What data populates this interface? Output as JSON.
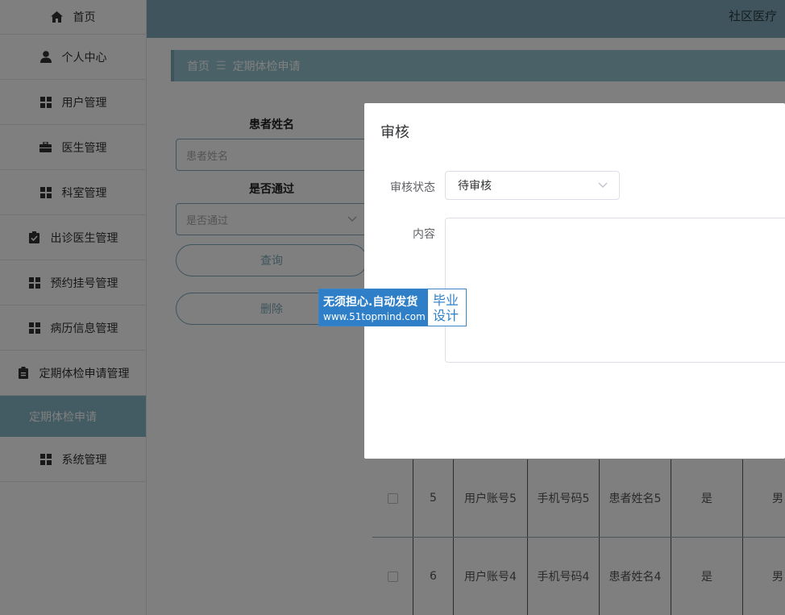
{
  "header": {
    "system_title": "社区医疗"
  },
  "sidebar": {
    "items": [
      {
        "label": "首页",
        "icon": "home-icon"
      },
      {
        "label": "个人中心",
        "icon": "user-icon"
      },
      {
        "label": "用户管理",
        "icon": "grid-icon"
      },
      {
        "label": "医生管理",
        "icon": "briefcase-icon"
      },
      {
        "label": "科室管理",
        "icon": "grid-icon"
      },
      {
        "label": "出诊医生管理",
        "icon": "clipboard-check-icon"
      },
      {
        "label": "预约挂号管理",
        "icon": "grid-icon"
      },
      {
        "label": "病历信息管理",
        "icon": "grid-icon"
      },
      {
        "label": "定期体检申请管理",
        "icon": "clipboard-icon"
      },
      {
        "label": "定期体检申请",
        "icon": ""
      },
      {
        "label": "系统管理",
        "icon": "grid-icon"
      }
    ]
  },
  "breadcrumb": {
    "home": "首页",
    "separator": "☰",
    "current": "定期体检申请"
  },
  "search": {
    "name_label": "患者姓名",
    "name_placeholder": "患者姓名",
    "pass_label": "是否通过",
    "pass_placeholder": "是否通过",
    "query_button": "查询",
    "delete_button": "删除"
  },
  "table": {
    "rows": [
      {
        "index": "5",
        "account": "用户账号5",
        "phone": "手机号码5",
        "name": "患者姓名5",
        "passed": "是",
        "gender": "男"
      },
      {
        "index": "6",
        "account": "用户账号4",
        "phone": "手机号码4",
        "name": "患者姓名4",
        "passed": "是",
        "gender": "男"
      }
    ]
  },
  "dialog": {
    "title": "审核",
    "status_label": "审核状态",
    "status_value": "待审核",
    "content_label": "内容"
  },
  "watermark": {
    "line1": "无须担心.自动发货",
    "line2": "www.51topmind.com",
    "right1": "毕业",
    "right2": "设计"
  },
  "colors": {
    "accent": "#7fa9bb",
    "active_menu": "#86b7c4",
    "overlay": "rgba(0,0,0,0.5)"
  }
}
